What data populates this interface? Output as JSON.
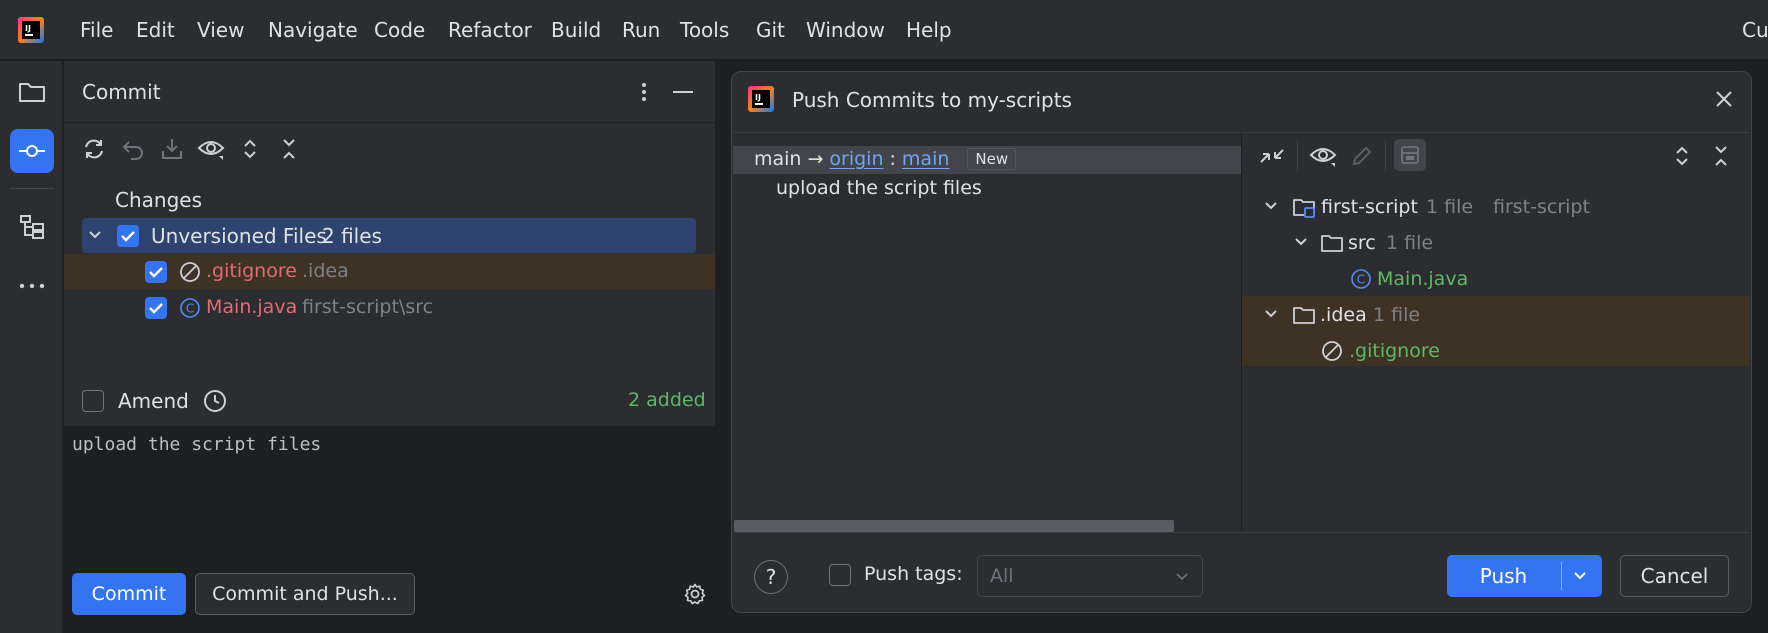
{
  "menubar": {
    "items": [
      "File",
      "Edit",
      "View",
      "Navigate",
      "Code",
      "Refactor",
      "Build",
      "Run",
      "Tools",
      "Git",
      "Window",
      "Help"
    ],
    "right_text": "Cu"
  },
  "commit_panel": {
    "title": "Commit",
    "changes_label": "Changes",
    "unversioned": {
      "label": "Unversioned Files",
      "count": "2 files"
    },
    "files": [
      {
        "name": ".gitignore",
        "path": ".idea"
      },
      {
        "name": "Main.java",
        "path": "first-script\\src"
      }
    ],
    "amend_label": "Amend",
    "added_status": "2 added",
    "commit_message": "upload the script files",
    "commit_button": "Commit",
    "commit_push_button": "Commit and Push..."
  },
  "push_dialog": {
    "title": "Push Commits to my-scripts",
    "branch": {
      "local": "main",
      "arrow": "→",
      "remote": "origin",
      "colon": ":",
      "remote_branch": "main",
      "badge": "New"
    },
    "commit_entry": "upload the script files",
    "tree": [
      {
        "name": "first-script",
        "meta": "1 file",
        "extra": "first-script"
      },
      {
        "name": "src",
        "meta": "1 file"
      },
      {
        "name": "Main.java"
      },
      {
        "name": ".idea",
        "meta": "1 file"
      },
      {
        "name": ".gitignore"
      }
    ],
    "help_label": "?",
    "push_tags_label": "Push tags:",
    "push_tags_value": "All",
    "push_button": "Push",
    "cancel_button": "Cancel"
  },
  "colors": {
    "accent": "#3574f0",
    "unversioned_red": "#e06c75",
    "added_green": "#5fb865",
    "link_blue": "#6ea6f5"
  }
}
